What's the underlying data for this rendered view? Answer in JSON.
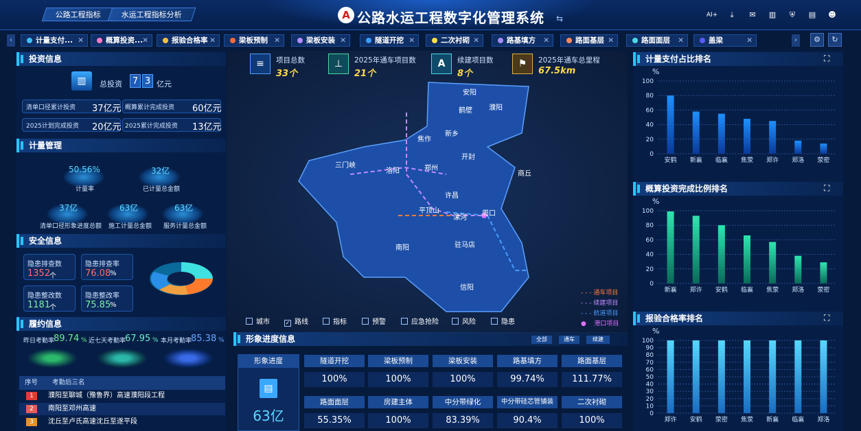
{
  "header": {
    "title": "公路水运工程数字化管理系统",
    "logo_text": "A",
    "swap_icon": "⇆",
    "nav_tabs": [
      "公路工程指标",
      "水运工程指标分析"
    ],
    "icons": [
      "ai-icon",
      "download-icon",
      "mail-icon",
      "bar-chart-icon",
      "shield-icon",
      "layout-icon",
      "user-icon"
    ],
    "ai_label": "AI+"
  },
  "tabs": [
    {
      "label": "计量支付...",
      "color": "#3ec0ff"
    },
    {
      "label": "概算投资...",
      "color": "#ff7ac8"
    },
    {
      "label": "报验合格率",
      "color": "#ffc040"
    },
    {
      "label": "梁板预制",
      "color": "#ff6a3c"
    },
    {
      "label": "梁板安装",
      "color": "#b48cff"
    },
    {
      "label": "隧道开挖",
      "color": "#3c9cff"
    },
    {
      "label": "二次衬砌",
      "color": "#ffe14a"
    },
    {
      "label": "路基填方",
      "color": "#a78bfa"
    },
    {
      "label": "路面基层",
      "color": "#ff8a5c"
    },
    {
      "label": "路面面层",
      "color": "#4fd8e8"
    },
    {
      "label": "盖梁",
      "color": "#5b5bff"
    }
  ],
  "investment": {
    "title": "投资信息",
    "total_label": "总投资",
    "total_digits": [
      "7",
      "3"
    ],
    "total_unit": "亿元",
    "items": [
      {
        "label": "清单口径累计投资",
        "value": "37亿元"
      },
      {
        "label": "概算累计完成投资",
        "value": "60亿元"
      },
      {
        "label": "2025计划完成投资",
        "value": "20亿元"
      },
      {
        "label": "2025累计完成投资",
        "value": "13亿元"
      }
    ]
  },
  "metering": {
    "title": "计量管理",
    "items": [
      {
        "value": "50.56%",
        "label": "计量率"
      },
      {
        "value": "32亿",
        "label": "已计量总金额"
      },
      {
        "value": "37亿",
        "label": "清单口径形象进度总额"
      },
      {
        "value": "63亿",
        "label": "施工计量总金额"
      },
      {
        "value": "63亿",
        "label": "服务计量总金额"
      }
    ]
  },
  "safety": {
    "title": "安全信息",
    "items": [
      {
        "label": "隐患排查数",
        "value": "1352",
        "unit": "个",
        "color": "#ff6b6b"
      },
      {
        "label": "隐患排查率",
        "value": "76.08",
        "unit": "%",
        "color": "#ff6b6b"
      },
      {
        "label": "隐患整改数",
        "value": "1181",
        "unit": "个",
        "color": "#7ef0a0"
      },
      {
        "label": "隐患整改率",
        "value": "75.85",
        "unit": "%",
        "color": "#7ef0a0"
      }
    ]
  },
  "contract": {
    "title": "履约信息",
    "stats": [
      {
        "label": "昨日考勤率",
        "value": "89.74",
        "unit": "%",
        "color": "#6cf08a"
      },
      {
        "label": "近七天考勤率",
        "value": "67.95",
        "unit": "%",
        "color": "#6cf0c8"
      },
      {
        "label": "本月考勤率",
        "value": "85.38",
        "unit": "%",
        "color": "#6aa6ff"
      }
    ],
    "table_headers": [
      "序号",
      "考勤后三名"
    ],
    "rows": [
      {
        "rank": "1",
        "name": "濮阳至聊城（豫鲁界）高速濮阳段工程",
        "color": "#e03a3a"
      },
      {
        "rank": "2",
        "name": "南阳至邓州高速",
        "color": "#e85a5a"
      },
      {
        "rank": "3",
        "name": "沈丘至卢氏高速沈丘至遂平段",
        "color": "#e8902a"
      }
    ]
  },
  "kpis": [
    {
      "label": "项目总数",
      "value": "33个",
      "icon": "layers-icon"
    },
    {
      "label": "2025年通车项目数",
      "value": "21个",
      "icon": "road-sign-icon"
    },
    {
      "label": "续建项目数",
      "value": "8个",
      "icon": "letter-a-icon"
    },
    {
      "label": "2025年通车总里程",
      "value": "67.5km",
      "icon": "flag-icon"
    }
  ],
  "map": {
    "cities": [
      "安阳",
      "鹤壁",
      "濮阳",
      "焦作",
      "新乡",
      "三门峡",
      "洛阳",
      "郑州",
      "开封",
      "商丘",
      "许昌",
      "平顶山",
      "漯河",
      "周口",
      "南阳",
      "驻马店",
      "信阳"
    ],
    "layers": [
      {
        "label": "城市",
        "checked": false
      },
      {
        "label": "路线",
        "checked": true
      },
      {
        "label": "指标",
        "checked": false
      },
      {
        "label": "预警",
        "checked": false
      },
      {
        "label": "应急抢险",
        "checked": false
      },
      {
        "label": "风险",
        "checked": false
      },
      {
        "label": "隐患",
        "checked": false
      }
    ],
    "legend": [
      {
        "label": "通车项目",
        "color": "#ff7a3c"
      },
      {
        "label": "续建项目",
        "color": "#c08cff"
      },
      {
        "label": "航道项目",
        "color": "#4a9dff"
      },
      {
        "label": "港口项目",
        "color": "#e070ff"
      }
    ]
  },
  "progress": {
    "title": "形象进度信息",
    "filters": [
      "全部",
      "通车",
      "续建"
    ],
    "main_label": "形象进度",
    "main_value": "63亿",
    "items": [
      {
        "label": "隧道开挖",
        "value": "100%"
      },
      {
        "label": "梁板预制",
        "value": "100%"
      },
      {
        "label": "梁板安装",
        "value": "100%"
      },
      {
        "label": "路基填方",
        "value": "99.74%"
      },
      {
        "label": "路面基层",
        "value": "111.77%"
      },
      {
        "label": "路面面层",
        "value": "55.35%"
      },
      {
        "label": "房建主体",
        "value": "100%"
      },
      {
        "label": "中分带绿化",
        "value": "83.39%"
      },
      {
        "label": "中分带硅芯管铺装",
        "value": "90.4%"
      },
      {
        "label": "二次衬砌",
        "value": "100%"
      }
    ]
  },
  "chart_data": [
    {
      "type": "bar",
      "title": "计量支付占比排名",
      "ylabel": "%",
      "categories": [
        "安鹤",
        "新襄",
        "临襄",
        "焦荥",
        "郑许",
        "郑洛",
        "荥密"
      ],
      "values": [
        80,
        58,
        55,
        48,
        45,
        18,
        14
      ],
      "ylim": [
        0,
        100
      ],
      "yticks": [
        0,
        20,
        40,
        60,
        80,
        100
      ],
      "colors": [
        "#1e90ff",
        "#0a3a9a"
      ],
      "grid": true
    },
    {
      "type": "bar",
      "title": "概算投资完成比例排名",
      "ylabel": "%",
      "categories": [
        "新襄",
        "郑许",
        "安鹤",
        "临襄",
        "焦荥",
        "郑洛",
        "荥密"
      ],
      "values": [
        99,
        93,
        80,
        66,
        57,
        38,
        29
      ],
      "ylim": [
        0,
        100
      ],
      "yticks": [
        0,
        20,
        40,
        60,
        80,
        100
      ],
      "colors": [
        "#2ee6b0",
        "#0a6a5a"
      ],
      "grid": true
    },
    {
      "type": "bar",
      "title": "报验合格率排名",
      "ylabel": "%",
      "categories": [
        "郑许",
        "安鹤",
        "荥密",
        "焦荥",
        "新襄",
        "临襄",
        "郑洛"
      ],
      "values": [
        100,
        100,
        100,
        100,
        100,
        100,
        100
      ],
      "ylim": [
        0,
        100
      ],
      "yticks": [
        0,
        10,
        20,
        30,
        40,
        50,
        60,
        70,
        80,
        90,
        100
      ],
      "colors": [
        "#56d8ff",
        "#1a6cc0"
      ],
      "grid": true
    }
  ]
}
